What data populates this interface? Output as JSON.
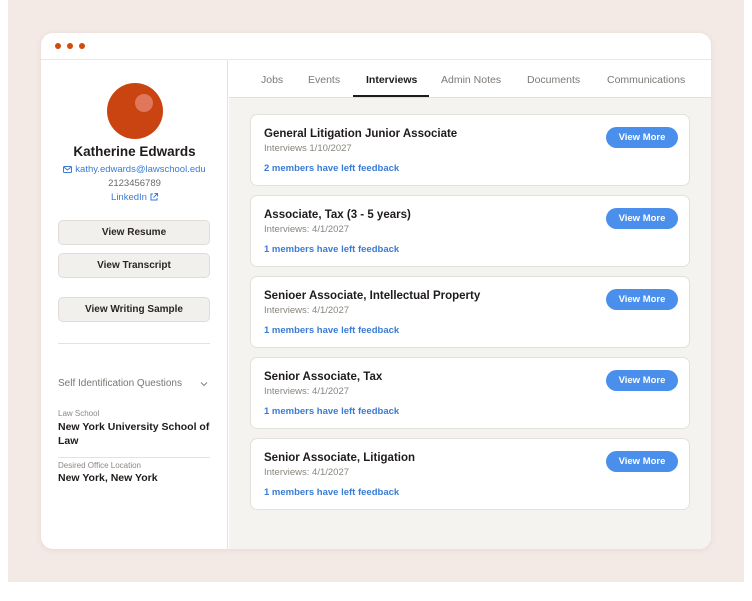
{
  "profile": {
    "name": "Katherine Edwards",
    "email": "kathy.edwards@lawschool.edu",
    "phone": "2123456789",
    "linkedin": "LinkedIn",
    "buttons": {
      "resume": "View Resume",
      "transcript": "View Transcript",
      "writing_sample": "View Writing Sample"
    },
    "self_identification": "Self Identification Questions",
    "fields": [
      {
        "label": "Law School",
        "value": "New York University School of Law"
      },
      {
        "label": "Desired Office Location",
        "value": "New York, New York"
      }
    ]
  },
  "tabs": [
    "Jobs",
    "Events",
    "Interviews",
    "Admin Notes",
    "Documents",
    "Communications"
  ],
  "active_tab": "Interviews",
  "interviews": [
    {
      "title": "General Litigation Junior Associate",
      "date": "Interviews 1/10/2027",
      "feedback": "2 members have left feedback",
      "button": "View More"
    },
    {
      "title": "Associate, Tax (3 - 5 years)",
      "date": "Interviews: 4/1/2027",
      "feedback": "1 members have left feedback",
      "button": "View More"
    },
    {
      "title": "Senioer Associate, Intellectual Property",
      "date": "Interviews: 4/1/2027",
      "feedback": "1 members have left feedback",
      "button": "View More"
    },
    {
      "title": "Senior Associate, Tax",
      "date": "Interviews: 4/1/2027",
      "feedback": "1 members have left feedback",
      "button": "View More"
    },
    {
      "title": "Senior Associate, Litigation",
      "date": "Interviews: 4/1/2027",
      "feedback": "1 members have left feedback",
      "button": "View More"
    }
  ],
  "colors": {
    "accent": "#4a8fec",
    "link": "#3a7bd5",
    "avatar": "#c94410",
    "window_dots": "#d24a0e",
    "backdrop": "#f3e9e5"
  },
  "icons": {
    "email": "envelope-icon",
    "linkedin_external": "external-link-icon",
    "dropdown": "chevron-down-icon"
  }
}
